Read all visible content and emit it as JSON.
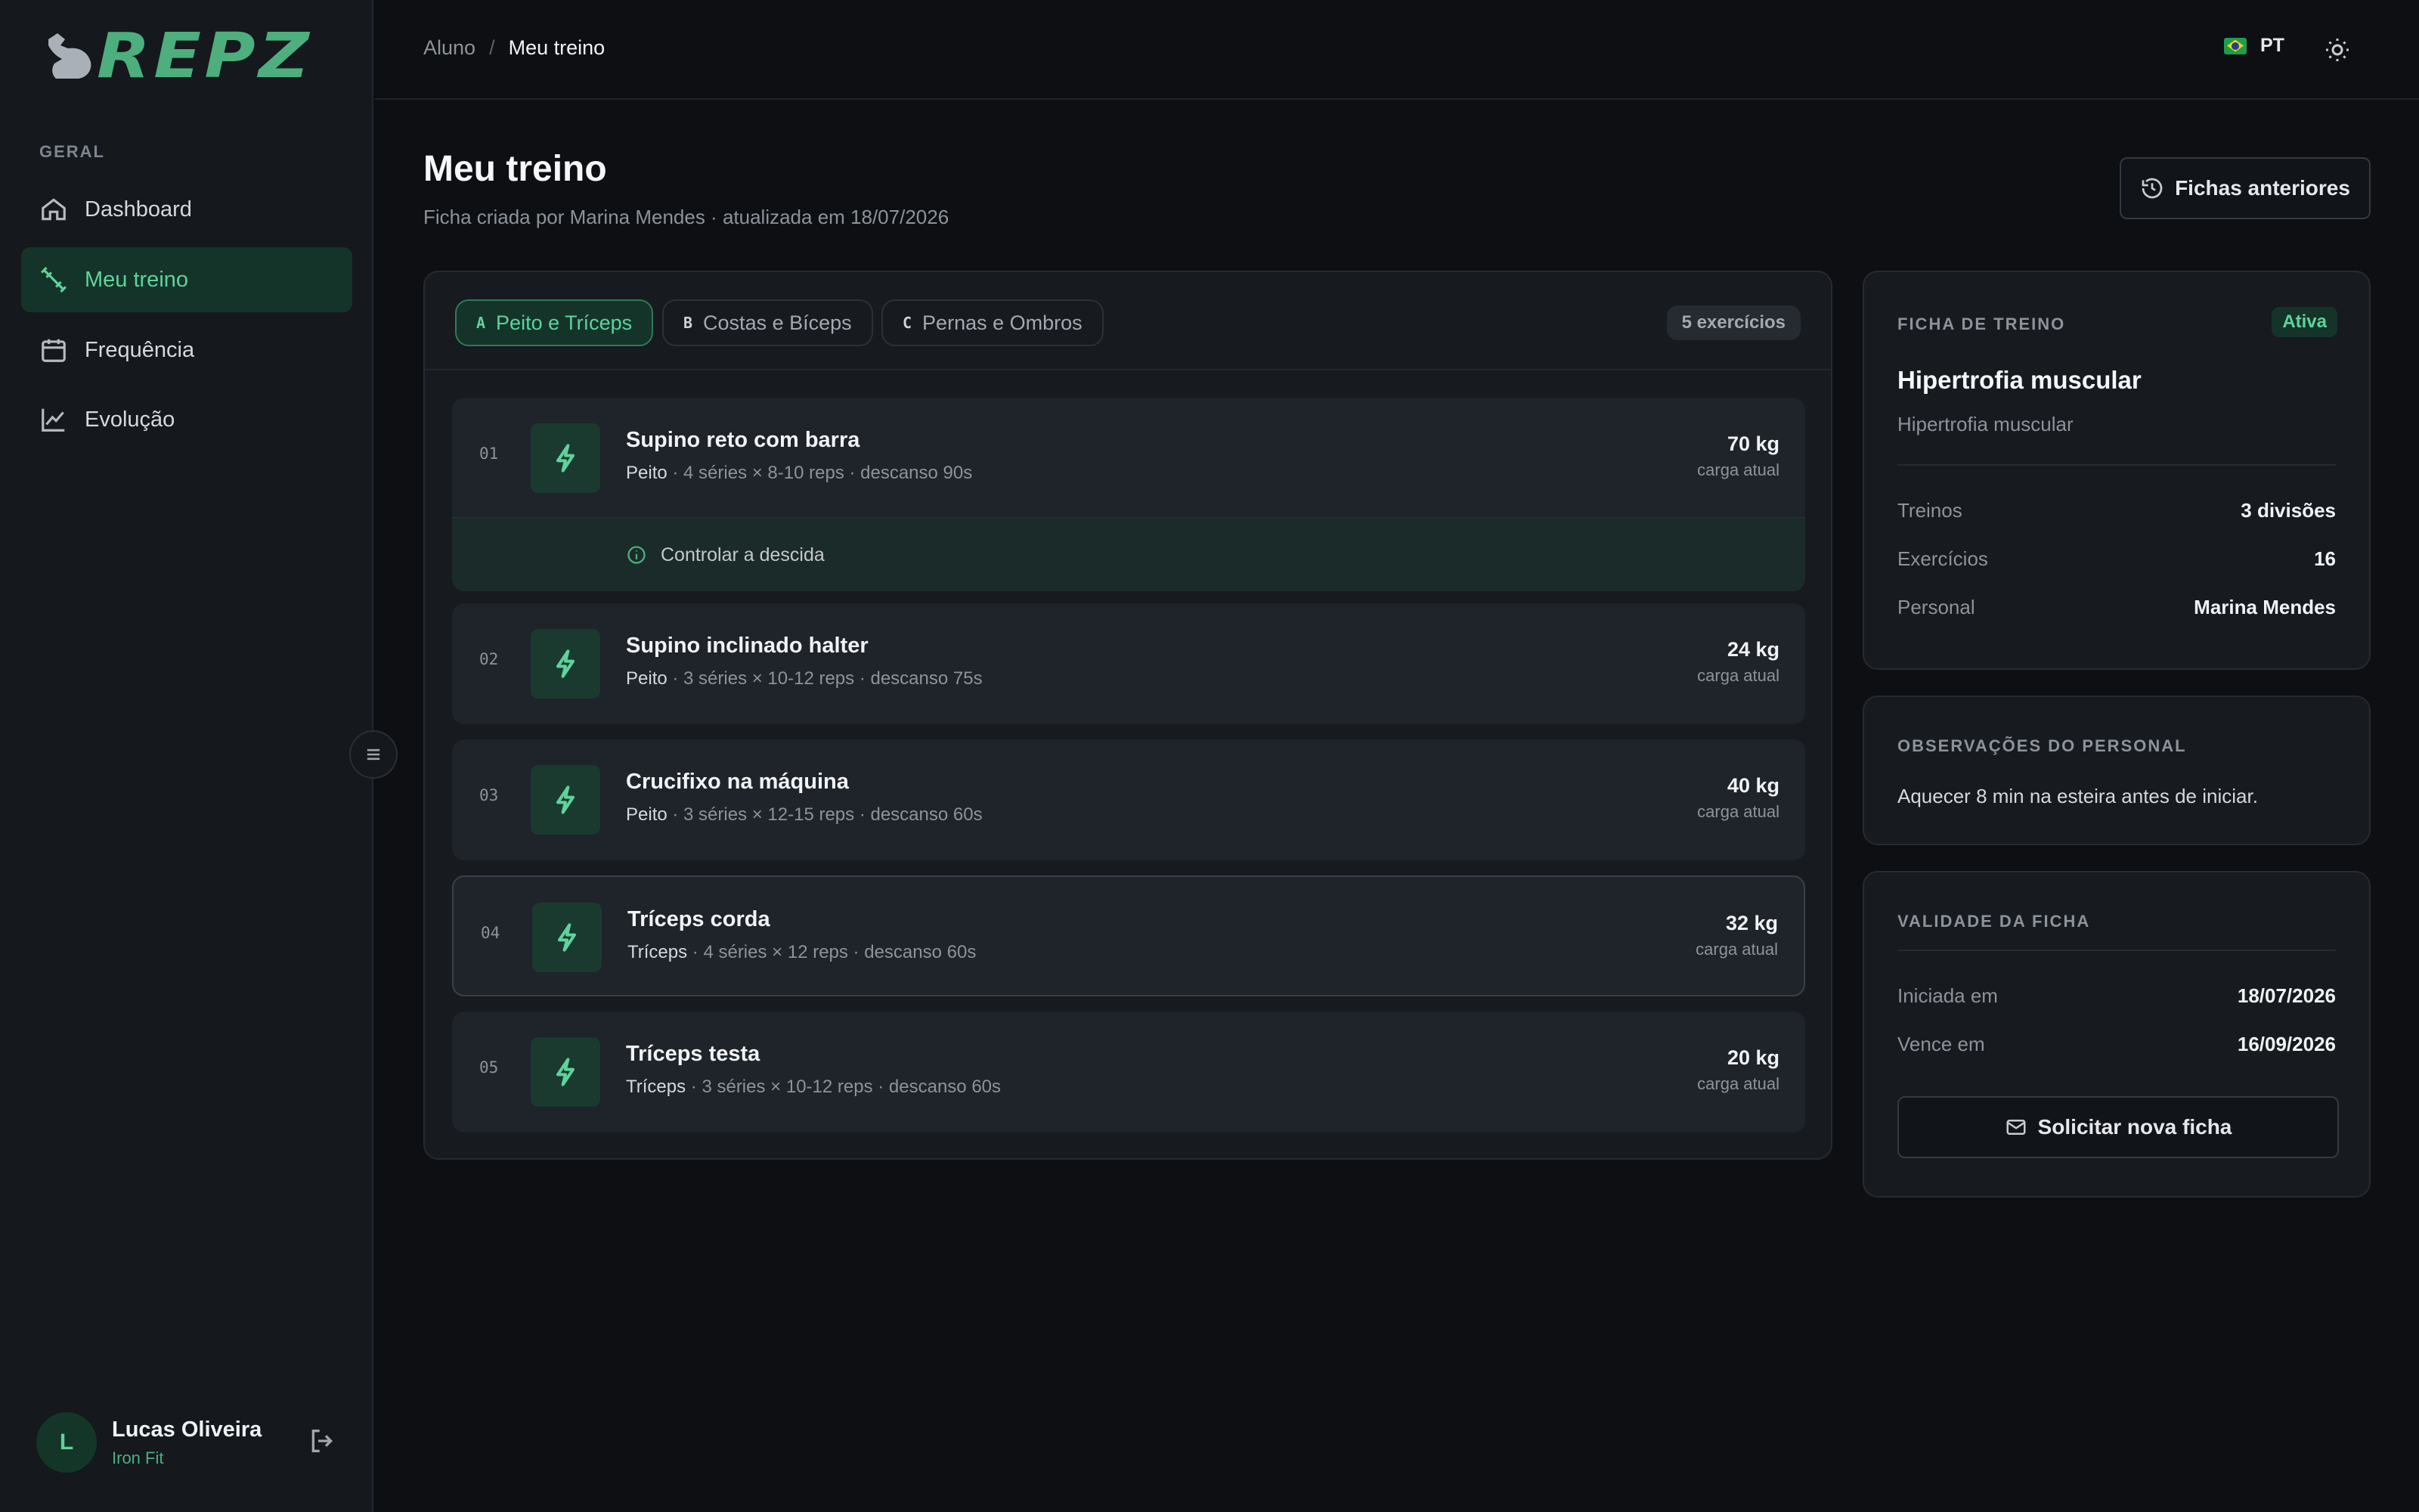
{
  "app": {
    "name": "REPZ"
  },
  "sidebar": {
    "section": "GERAL",
    "items": [
      {
        "label": "Dashboard",
        "icon": "home-icon"
      },
      {
        "label": "Meu treino",
        "icon": "dumbbell-icon",
        "active": true
      },
      {
        "label": "Frequência",
        "icon": "calendar-icon"
      },
      {
        "label": "Evolução",
        "icon": "chart-line-icon"
      }
    ],
    "user": {
      "initial": "L",
      "name": "Lucas Oliveira",
      "gym": "Iron Fit"
    }
  },
  "topbar": {
    "breadcrumb": [
      "Aluno",
      "Meu treino"
    ],
    "breadcrumb_sep": "/",
    "language": "PT"
  },
  "page": {
    "title": "Meu treino",
    "subtitle": "Ficha criada por Marina Mendes · atualizada em 18/07/2026",
    "previous_button": "Fichas anteriores"
  },
  "workout": {
    "tabs": [
      {
        "key": "A",
        "label": "Peito e Tríceps",
        "active": true
      },
      {
        "key": "B",
        "label": "Costas e Bíceps"
      },
      {
        "key": "C",
        "label": "Pernas e Ombros"
      }
    ],
    "count": "5 exercícios",
    "exercises": [
      {
        "num": "01",
        "name": "Supino reto com barra",
        "muscle": "Peito",
        "detail": " · 4 séries × 8-10 reps · descanso 90s",
        "load": "70 kg",
        "load_label": "carga atual",
        "note": "Controlar a descida"
      },
      {
        "num": "02",
        "name": "Supino inclinado halter",
        "muscle": "Peito",
        "detail": " · 3 séries × 10-12 reps · descanso 75s",
        "load": "24 kg",
        "load_label": "carga atual"
      },
      {
        "num": "03",
        "name": "Crucifixo na máquina",
        "muscle": "Peito",
        "detail": " · 3 séries × 12-15 reps · descanso 60s",
        "load": "40 kg",
        "load_label": "carga atual"
      },
      {
        "num": "04",
        "name": "Tríceps corda",
        "muscle": "Tríceps",
        "detail": " · 4 séries × 12 reps · descanso 60s",
        "load": "32 kg",
        "load_label": "carga atual"
      },
      {
        "num": "05",
        "name": "Tríceps testa",
        "muscle": "Tríceps",
        "detail": " · 3 séries × 10-12 reps · descanso 60s",
        "load": "20 kg",
        "load_label": "carga atual"
      }
    ]
  },
  "plan_card": {
    "heading": "FICHA DE TREINO",
    "status": "Ativa",
    "title": "Hipertrofia muscular",
    "goal": "Hipertrofia muscular",
    "rows": [
      {
        "k": "Treinos",
        "v": "3 divisões"
      },
      {
        "k": "Exercícios",
        "v": "16"
      },
      {
        "k": "Personal",
        "v": "Marina Mendes"
      }
    ]
  },
  "obs_card": {
    "heading": "OBSERVAÇÕES DO PERSONAL",
    "text": "Aquecer 8 min na esteira antes de iniciar."
  },
  "validity_card": {
    "heading": "VALIDADE DA FICHA",
    "rows": [
      {
        "k": "Iniciada em",
        "v": "18/07/2026"
      },
      {
        "k": "Vence em",
        "v": "16/09/2026"
      }
    ],
    "button": "Solicitar nova ficha"
  }
}
